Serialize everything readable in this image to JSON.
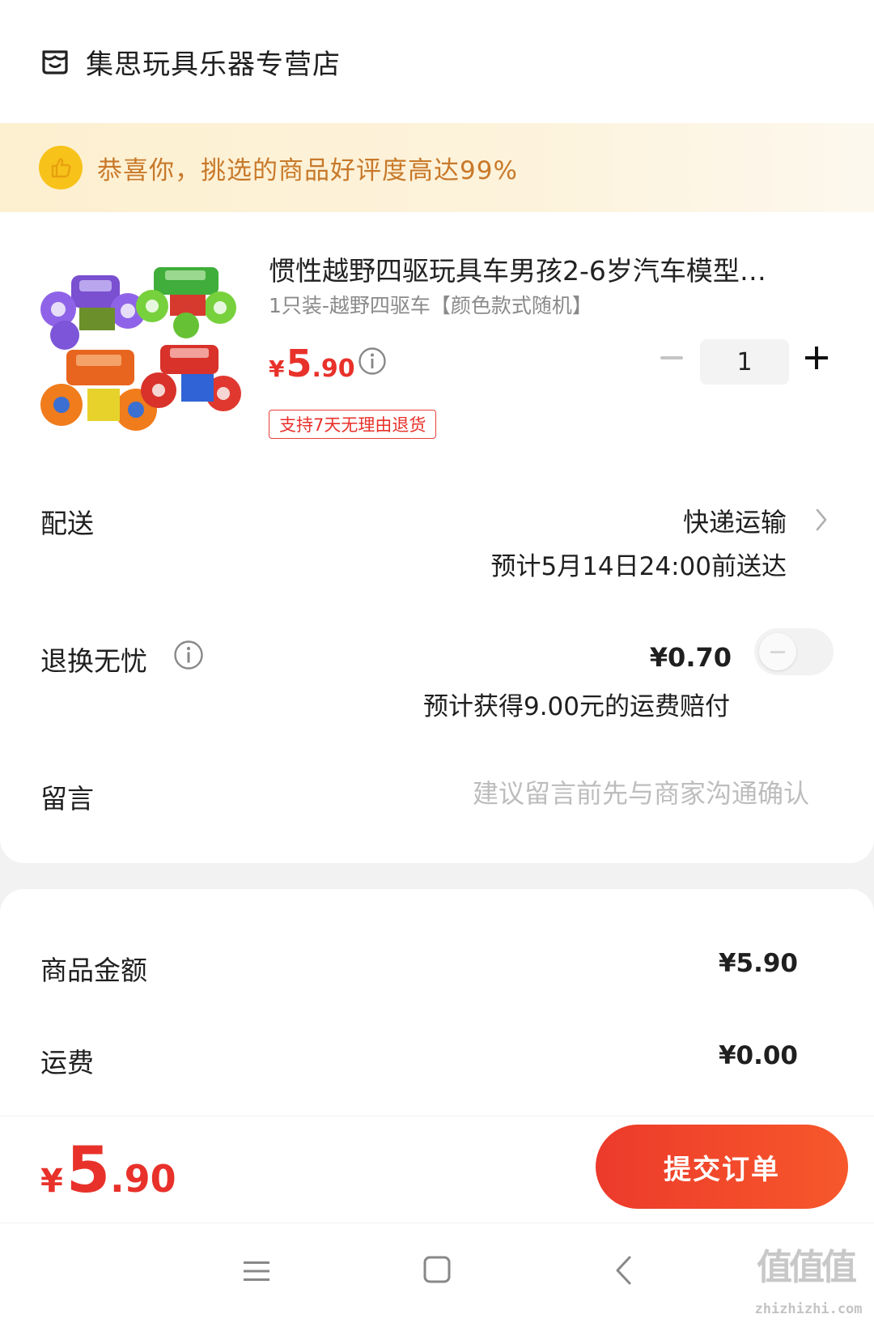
{
  "store": {
    "name": "集思玩具乐器专营店",
    "icon": "store-icon"
  },
  "banner": {
    "text": "恭喜你，挑选的商品好评度高达99%",
    "icon": "thumbs-up-icon",
    "accent": "#f7c21a"
  },
  "product": {
    "title": "惯性越野四驱玩具车男孩2-6岁汽车模型…",
    "sku": "1只装-越野四驱车【颜色款式随机】",
    "price_symbol": "¥",
    "price_int": "5",
    "price_dec": ".90",
    "quantity": "1",
    "return_tag": "支持7天无理由退货",
    "image": "toy-cars-image"
  },
  "delivery": {
    "label": "配送",
    "method": "快递运输",
    "eta": "预计5月14日24:00前送达"
  },
  "return_insurance": {
    "label": "退换无忧",
    "price": "¥0.70",
    "compensation": "预计获得9.00元的运费赔付",
    "enabled": false
  },
  "message": {
    "label": "留言",
    "placeholder": "建议留言前先与商家沟通确认"
  },
  "summary": {
    "goods_label": "商品金额",
    "goods_value": "¥5.90",
    "shipping_label": "运费",
    "shipping_value": "¥0.00"
  },
  "footer": {
    "total_symbol": "¥",
    "total_int": "5",
    "total_dec": ".90",
    "submit_label": "提交订单",
    "accent": "#e8312a"
  },
  "nav": {
    "watermark": "值值值",
    "watermark_sub": "zhizhizhi.com"
  }
}
